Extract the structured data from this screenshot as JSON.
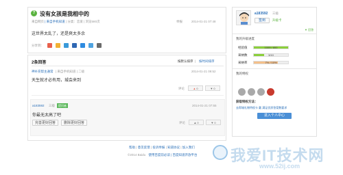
{
  "question": {
    "title": "没有女孩是我相中的",
    "meta_left": "来自网页",
    "meta_mid": "| 来自手机知道",
    "meta_cat": "| 分类：恋爱",
    "meta_views": "| 浏览580次",
    "report": "举报",
    "time": "2014-01-21 07:48",
    "body": "这世界太乱了，还是爽太多余",
    "share_label": "分享到："
  },
  "answers": {
    "header": "2条回答",
    "sort_default": "按默认排序",
    "sort_time": "按时间排序",
    "items": [
      {
        "user": "神补充帮主通常",
        "meta": "| 来自手机知道 | 二级",
        "time": "2014-01-21 09:52",
        "text": "天生就才必有用，城会来到",
        "comment": "评论",
        "up": "0",
        "down": "0"
      },
      {
        "user": "a183592",
        "level": "三级",
        "badge": "提问者",
        "time": "2014-01-21 07:55",
        "text": "你最无太高了吧",
        "btn1": "完善更好回答",
        "btn2": "删除更好回答",
        "comment": "评论",
        "up": "0",
        "down": "0"
      }
    ]
  },
  "sidebar": {
    "username": "a183592",
    "level": "三级",
    "btn_sign": "签到",
    "btn_upgrade": "升级卡",
    "collapse": "▼ 回答",
    "section1": "我的升级进度",
    "rows": [
      {
        "label": "经验值",
        "value": "1009 / 800",
        "progress": 1.0
      },
      {
        "label": "采纳数",
        "value": "3/10",
        "progress": 0.3
      },
      {
        "label": "采纳率",
        "value": "7% / 10%",
        "progress": 0.7
      }
    ],
    "section2": "我的特权",
    "get_way": "获取特权方法：",
    "get_desc": "去帮城礼物特权卡 戴 满足优质答案数要求",
    "enter_btn": "进入个人中心"
  },
  "footer": {
    "links": [
      "帮助",
      "意见反馈",
      "投诉举报",
      "知道协议",
      "加入我们"
    ],
    "copyright": "©2014 Baidu",
    "legal": "使用百度前必读 | 百度知道开放平台"
  },
  "watermark": {
    "cn": "我爱IT技术网",
    "url": "www.52ij.com"
  },
  "colors": {
    "accent": "#4a8fd6",
    "green": "#8bcf3a",
    "red": "#c83a2e",
    "badge": "#5cb85c"
  }
}
